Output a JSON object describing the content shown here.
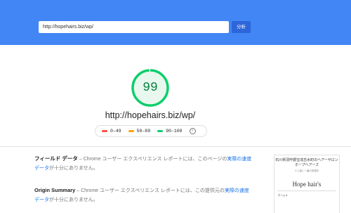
{
  "search": {
    "url_value": "http://hopehairs.biz/wp/",
    "analyze_label": "分析"
  },
  "result": {
    "score": "99",
    "url": "http://hopehairs.biz/wp/"
  },
  "legend": [
    {
      "label": "0–49",
      "color": "#ff4e42"
    },
    {
      "label": "50–89",
      "color": "#ffa400"
    },
    {
      "label": "90–100",
      "color": "#0cce6b"
    }
  ],
  "info_icon_label": "i",
  "field_data": {
    "title": "フィールド データ",
    "text_pre": " – Chrome ユーザー エクスペリエンス レポートには、このページの",
    "link": "実際の速度データ",
    "text_post": "が十分にありません。"
  },
  "origin_summary": {
    "title": "Origin Summary",
    "text_pre": " – Chrome ユーザー エクスペリエンス レポートには、この提供元の",
    "link": "実際の速度データ",
    "text_post": "が十分にありません。"
  },
  "thumbnail": {
    "line1": "石川県羽咋郡宝達志水町のヘアーサロン　ホープヘアーズ",
    "line2": "人と髪に一番の笑顔を",
    "logo": "Hope hair's",
    "menu": "ホーム ▾"
  },
  "colors": {
    "header": "#4285f4",
    "score_good": "#0cce6b",
    "score_text": "#0b8043"
  },
  "score_fraction": 0.99
}
